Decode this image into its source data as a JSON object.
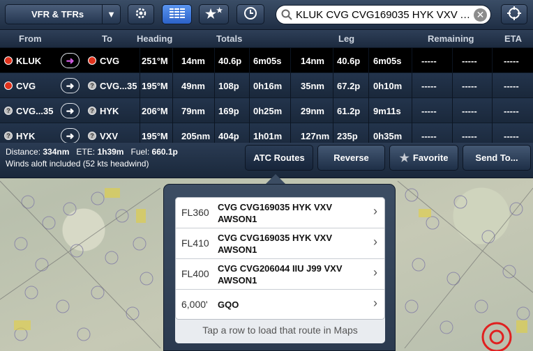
{
  "toolbar": {
    "layer_label": "VFR & TFRs",
    "search_value": "KLUK CVG CVG169035 HYK VXV A..."
  },
  "table": {
    "headers": {
      "from": "From",
      "to": "To",
      "heading": "Heading",
      "totals": "Totals",
      "leg": "Leg",
      "remaining": "Remaining",
      "eta": "ETA"
    },
    "rows": [
      {
        "from": "KLUK",
        "from_type": "airport",
        "to": "CVG",
        "to_type": "airport",
        "heading": "251°M",
        "t_dist": "14nm",
        "t_fuel": "40.6p",
        "t_time": "6m05s",
        "l_dist": "14nm",
        "l_fuel": "40.6p",
        "l_time": "6m05s",
        "rem_dist": "-----",
        "rem_time": "-----",
        "eta": "-----",
        "selected": true
      },
      {
        "from": "CVG",
        "from_type": "airport",
        "to": "CVG...35",
        "to_type": "fix",
        "heading": "195°M",
        "t_dist": "49nm",
        "t_fuel": "108p",
        "t_time": "0h16m",
        "l_dist": "35nm",
        "l_fuel": "67.2p",
        "l_time": "0h10m",
        "rem_dist": "-----",
        "rem_time": "-----",
        "eta": "-----",
        "selected": false
      },
      {
        "from": "CVG...35",
        "from_type": "fix",
        "to": "HYK",
        "to_type": "fix",
        "heading": "206°M",
        "t_dist": "79nm",
        "t_fuel": "169p",
        "t_time": "0h25m",
        "l_dist": "29nm",
        "l_fuel": "61.2p",
        "l_time": "9m11s",
        "rem_dist": "-----",
        "rem_time": "-----",
        "eta": "-----",
        "selected": false
      },
      {
        "from": "HYK",
        "from_type": "fix",
        "to": "VXV",
        "to_type": "fix",
        "heading": "195°M",
        "t_dist": "205nm",
        "t_fuel": "404p",
        "t_time": "1h01m",
        "l_dist": "127nm",
        "l_fuel": "235p",
        "l_time": "0h35m",
        "rem_dist": "-----",
        "rem_time": "-----",
        "eta": "-----",
        "selected": false
      }
    ]
  },
  "summary": {
    "distance_label": "Distance:",
    "distance": "334nm",
    "ete_label": "ETE:",
    "ete": "1h39m",
    "fuel_label": "Fuel:",
    "fuel": "660.1p",
    "winds": "Winds aloft included (52 kts headwind)",
    "buttons": {
      "atc": "ATC Routes",
      "reverse": "Reverse",
      "favorite": "Favorite",
      "send": "Send To..."
    }
  },
  "atc_routes": {
    "routes": [
      {
        "altitude": "FL360",
        "route": "CVG CVG169035 HYK VXV AWSON1"
      },
      {
        "altitude": "FL410",
        "route": "CVG CVG169035 HYK VXV AWSON1"
      },
      {
        "altitude": "FL400",
        "route": "CVG CVG206044 IIU J99 VXV AWSON1"
      },
      {
        "altitude": "6,000'",
        "route": "GQO"
      }
    ],
    "hint": "Tap a row to load that route in Maps"
  },
  "colors": {
    "toolbar": "#2c3e57",
    "active_button": "#3b7be0",
    "airport_dot": "#e0321c",
    "direct_arrow": "#d05ce0"
  },
  "icons": [
    "gear-icon",
    "list-icon",
    "star-icon",
    "clock-icon",
    "search-icon",
    "clear-icon",
    "crosshair-icon",
    "chevron-right-icon"
  ]
}
